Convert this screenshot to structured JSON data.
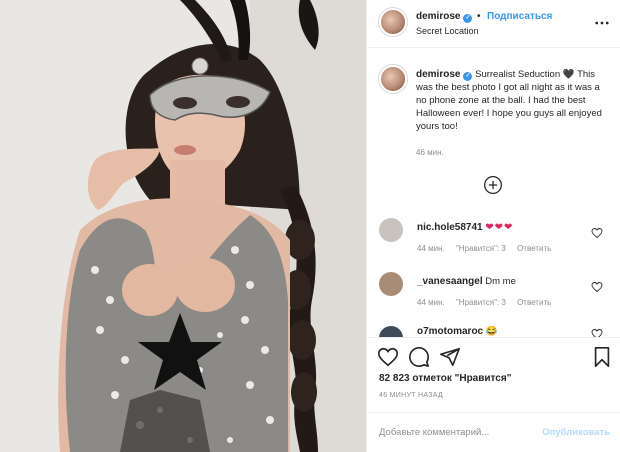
{
  "post": {
    "username": "demirose",
    "verified_mark": "✓",
    "separator": "•",
    "follow_label": "Подписаться",
    "location": "Secret Location",
    "caption_title": "Surrealist Seduction",
    "caption_emoji": "🖤",
    "caption_body": "This was the best photo I got all night as it was a no phone zone at the ball. I had the best Halloween ever! I hope you guys all enjoyed yours too!",
    "caption_time": "46 мин."
  },
  "comments": [
    {
      "username": "nic.hole58741",
      "text": "❤❤❤",
      "time": "44 мин.",
      "likes": "\"Нравится\": 3",
      "reply": "Ответить",
      "avatar_color": "#c9c3bd"
    },
    {
      "username": "_vanesaangel",
      "text": "Dm me",
      "time": "44 мин.",
      "likes": "\"Нравится\": 3",
      "reply": "Ответить",
      "avatar_color": "#a98c78"
    },
    {
      "username": "o7motomaroc",
      "text": "😂",
      "time": "",
      "likes": "",
      "reply": "",
      "avatar_color": "#3e4a55"
    }
  ],
  "likes_text": "82 823 отметок \"Нравится\"",
  "posted_time": "46 МИНУТ НАЗАД",
  "comment_input": {
    "placeholder": "Добавьте комментарий...",
    "publish_label": "Опубликовать"
  },
  "icons": {
    "more": "more-icon",
    "load_more": "plus-circle-icon",
    "like": "heart-icon",
    "comment": "comment-icon",
    "share": "share-icon",
    "save": "bookmark-icon"
  },
  "colors": {
    "accent": "#3897f0",
    "publish_disabled": "#b3dbff",
    "muted": "#8e8e8e",
    "heart": "#e0245e"
  }
}
